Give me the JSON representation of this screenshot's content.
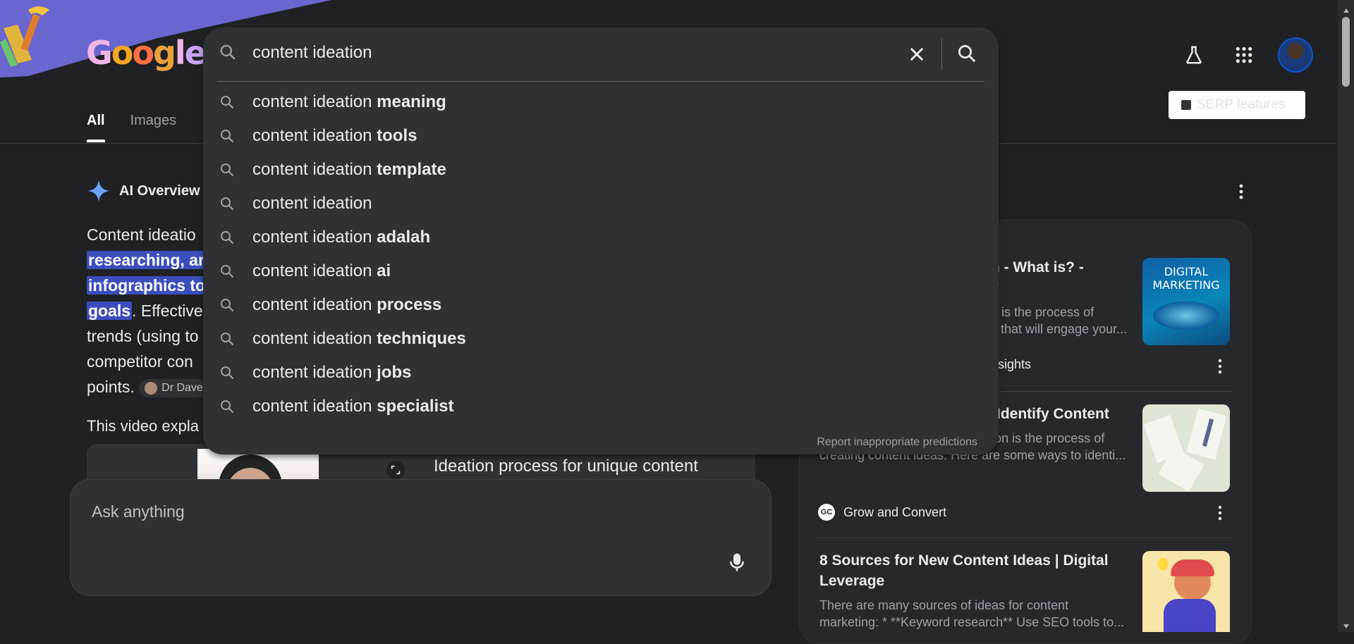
{
  "logo": {
    "letters": [
      "G",
      "o",
      "o",
      "g",
      "l",
      "e"
    ],
    "colors": [
      "#f0b6e8",
      "#f5a623",
      "#ff7043",
      "#e8a13a",
      "#f0b6e8",
      "#cba6f7"
    ]
  },
  "search": {
    "query": "content ideation",
    "clear_label": "Clear",
    "report_label": "Report inappropriate predictions"
  },
  "suggestions": [
    {
      "base": "content ideation",
      "bold": " meaning"
    },
    {
      "base": "content ideation",
      "bold": " tools"
    },
    {
      "base": "content ideation",
      "bold": " template"
    },
    {
      "base": "content ideation",
      "bold": ""
    },
    {
      "base": "content ideation",
      "bold": " adalah"
    },
    {
      "base": "content ideation",
      "bold": " ai"
    },
    {
      "base": "content ideation",
      "bold": " process"
    },
    {
      "base": "content ideation",
      "bold": " techniques"
    },
    {
      "base": "content ideation",
      "bold": " jobs"
    },
    {
      "base": "content ideation",
      "bold": " specialist"
    }
  ],
  "header": {
    "serp_label": "SERP features"
  },
  "tabs": [
    {
      "label": "All"
    },
    {
      "label": "Images"
    }
  ],
  "ai_overview": {
    "title": "AI Overview",
    "line1": "Content ideatio",
    "hl1": "researching, ar",
    "hl2": "infographics to",
    "hl3": "goals",
    "line4_rest": ". Effective",
    "line5": "trends (using to",
    "line6": "competitor con",
    "line7": "points.",
    "chip_label": "Dr Dave",
    "video_intro": "This video expla",
    "video_title": "Ideation process for unique content"
  },
  "ask": {
    "placeholder": "Ask anything"
  },
  "results": [
    {
      "title": "n - What is? -",
      "title2": "y",
      "snippet1": "n is the process of",
      "snippet2": "s that will engage your...",
      "source": "nsights"
    },
    {
      "title": "Identify Content",
      "snippet1": "May 13, 2023 — Content ideation is the process of",
      "snippet2": "creating content ideas. Here are some ways to identi...",
      "source": "Grow and Convert",
      "source_logo": "GC"
    },
    {
      "title": "8 Sources for New Content Ideas | Digital",
      "title2": "Leverage",
      "snippet1": "There are many sources of ideas for content",
      "snippet2": "marketing: * **Keyword research** Use SEO tools to...",
      "source": ""
    }
  ],
  "book": {
    "line1": "DIGITAL",
    "line2": "MARKETING"
  },
  "colors": {
    "background": "#202124",
    "surface": "#303134",
    "highlight": "#3c4dbd"
  }
}
